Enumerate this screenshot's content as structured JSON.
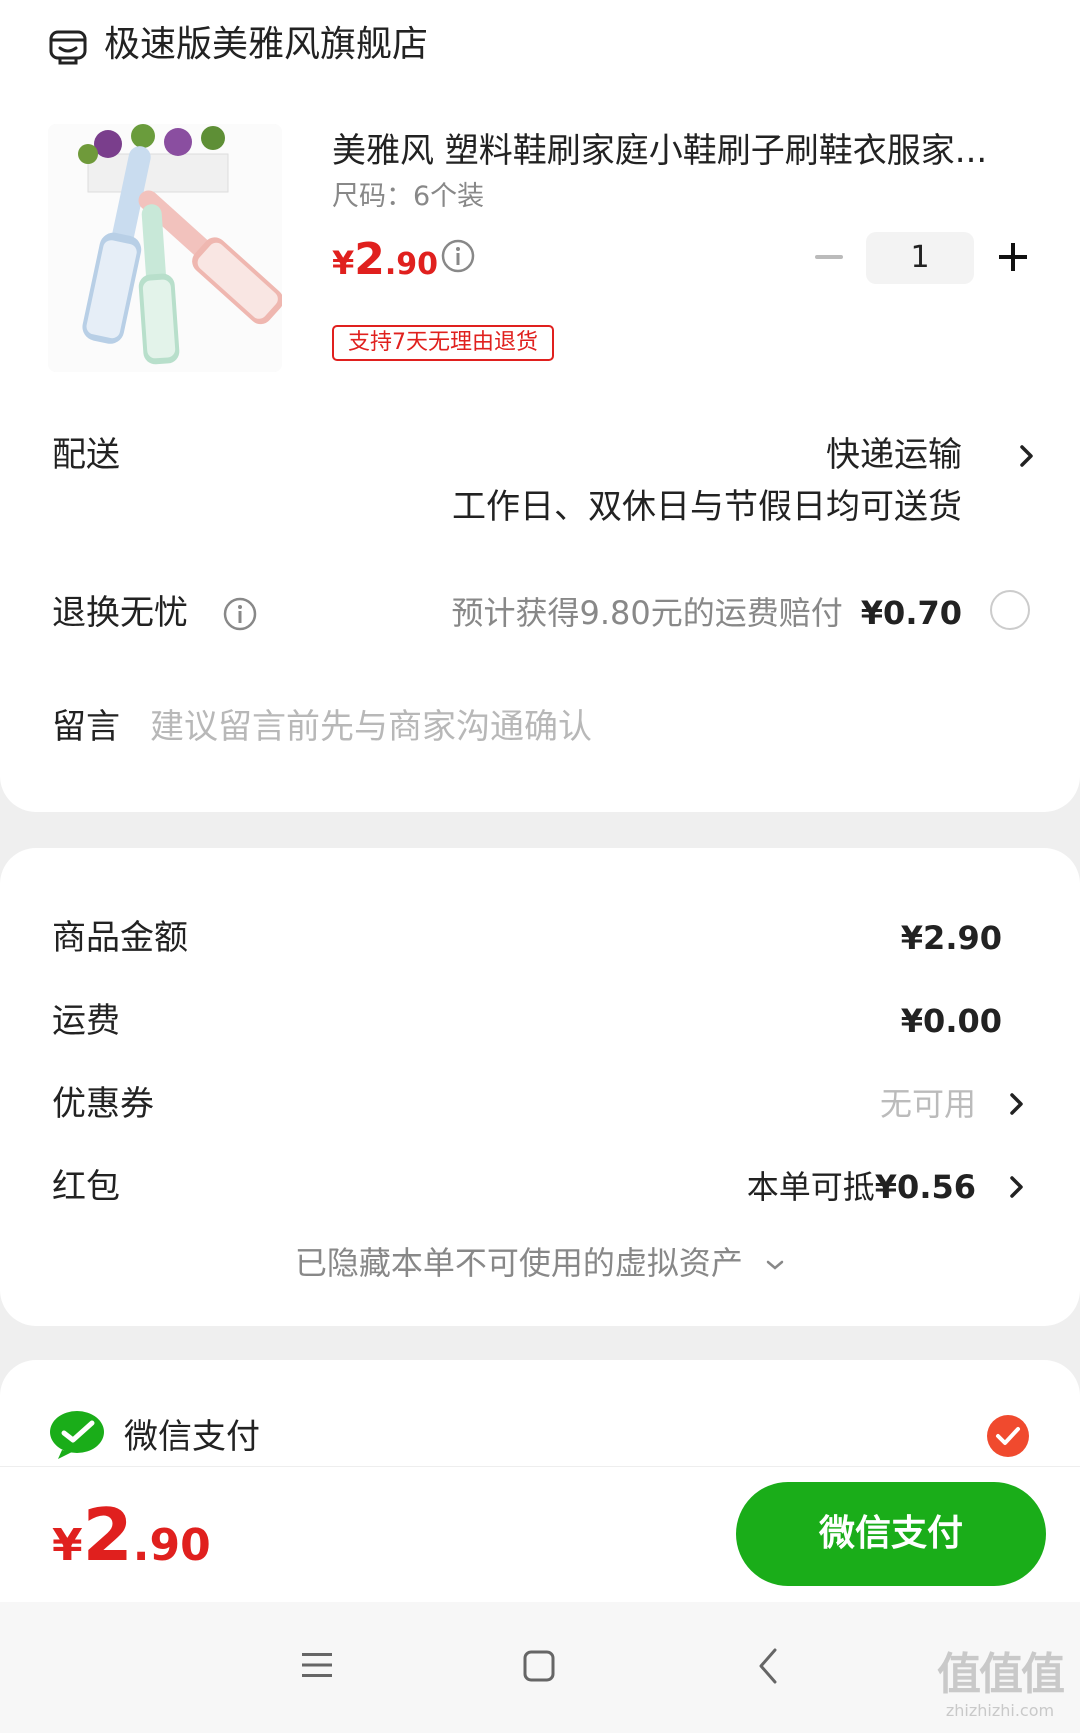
{
  "shop": {
    "name": "极速版美雅风旗舰店",
    "icon": "store-icon"
  },
  "product": {
    "title": "美雅风 塑料鞋刷家庭小鞋刷子刷鞋衣服家...",
    "spec": "尺码：6个装",
    "price_yen": "¥",
    "price_int": "2",
    "price_dec": ".90",
    "quantity": "1",
    "return_badge": "支持7天无理由退货"
  },
  "delivery": {
    "label": "配送",
    "method": "快递运输",
    "desc": "工作日、双休日与节假日均可送货"
  },
  "refund": {
    "label": "退换无忧",
    "desc": "预计获得9.80元的运费赔付",
    "amount": "¥0.70"
  },
  "message": {
    "label": "留言",
    "placeholder": "建议留言前先与商家沟通确认"
  },
  "fees": {
    "goods_label": "商品金额",
    "goods_value": "¥2.90",
    "shipping_label": "运费",
    "shipping_value": "¥0.00",
    "coupon_label": "优惠券",
    "coupon_value": "无可用",
    "redpacket_label": "红包",
    "redpacket_prefix": "本单可抵",
    "redpacket_value": "¥0.56",
    "hidden_assets": "已隐藏本单不可使用的虚拟资产"
  },
  "payment": {
    "method_label": "微信支付",
    "method_selected": true
  },
  "bottom": {
    "total_yen": "¥",
    "total_int": "2",
    "total_dec": ".90",
    "pay_button": "微信支付"
  },
  "watermark": {
    "big": "值值值",
    "small": "zhizhizhi.com"
  },
  "colors": {
    "accent_red": "#e0201e",
    "wechat_green": "#1aad19",
    "check_red": "#f04a2e"
  }
}
